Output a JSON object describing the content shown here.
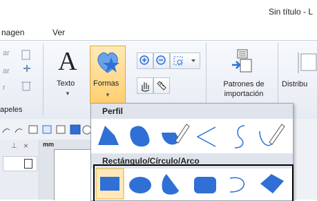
{
  "window": {
    "title": "Sin título - L"
  },
  "menu": {
    "items": [
      "nagen",
      "Ver"
    ]
  },
  "ribbon": {
    "texto_label": "Texto",
    "formas_label": "Formas",
    "patrones_line1": "Patrones de",
    "patrones_line2": "importación",
    "distribu_label": "Distribu",
    "papeles_label": "apeles",
    "left_small": [
      "ar",
      "ar",
      "r"
    ]
  },
  "ruler": {
    "unit": "mm"
  },
  "dropdown": {
    "sections": [
      {
        "title": "Perfil",
        "shapes": [
          "polygon-profile-icon",
          "closed-curve-icon",
          "bezier-pen-icon",
          "zigzag-line-icon",
          "s-curve-icon",
          "freehand-pen-icon"
        ]
      },
      {
        "title": "Rectángulo/Círculo/Arco",
        "shapes": [
          "rectangle-icon",
          "ellipse-icon",
          "fan-icon",
          "rounded-rectangle-icon",
          "arc-icon",
          "diamond-leaf-icon"
        ]
      }
    ]
  },
  "colors": {
    "shape_blue": "#2f6fd6",
    "highlight": "#ffcf70",
    "ribbon_bg": "#e6ebf3"
  }
}
